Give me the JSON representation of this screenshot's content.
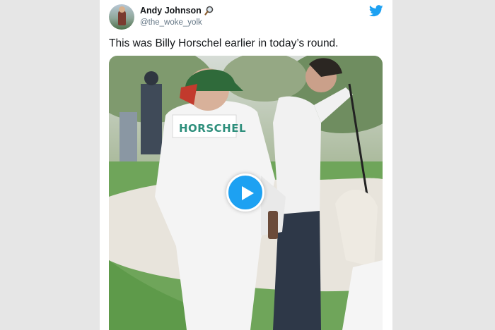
{
  "tweet": {
    "author_name": "Andy Johnson",
    "author_handle": "@the_woke_yolk",
    "text": "This was Billy Horschel earlier in today’s round.",
    "avatar_icon": "avatar-photo",
    "name_emoji_icon": "magnifying-glass-icon",
    "platform_icon": "twitter-bird-icon",
    "brand_color": "#1da1f2"
  },
  "media": {
    "type": "video",
    "jersey_text": "HORSCHEL",
    "play_button_icon": "play-icon"
  }
}
